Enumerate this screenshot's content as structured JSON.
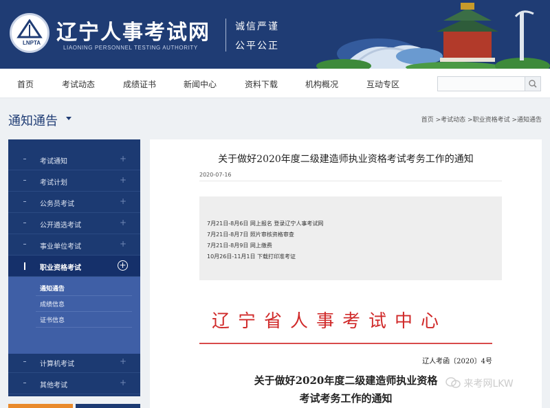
{
  "header": {
    "logo_abbr": "LNPTA",
    "site_title": "辽宁人事考试网",
    "site_subtitle": "LIAONING PERSONNEL TESTING AUTHORITY",
    "motto_line1": "诚信严谨",
    "motto_line2": "公平公正",
    "colors": {
      "brand": "#1f3c74"
    }
  },
  "nav": {
    "items": [
      "首页",
      "考试动态",
      "成绩证书",
      "新闻中心",
      "资料下载",
      "机构概况",
      "互动专区"
    ],
    "search_value": ""
  },
  "section": {
    "title": "通知通告",
    "breadcrumb": "首页 >考试动态 >职业资格考试 >通知通告"
  },
  "sidebar": {
    "items": [
      "考试通知",
      "考试计划",
      "公务员考试",
      "公开遴选考试",
      "事业单位考试",
      "职业资格考试",
      "计算机考试",
      "其他考试"
    ],
    "active_item": "职业资格考试",
    "sub_items": [
      "通知通告",
      "成绩信息",
      "证书信息"
    ],
    "active_sub_item": "通知通告"
  },
  "article": {
    "title": "关于做好2020年度二级建造师执业资格考试考务工作的通知",
    "date": "2020-07-16",
    "schedule": [
      "7月21日-8月6日  网上报名  登录辽宁人事考试网",
      "7月21日-8月7日  照片审核资格审查",
      "7月21日-8月9日  网上缴费",
      "10月26日-11月1日  下载打印准考证"
    ],
    "issuer": "辽宁省人事考试中心",
    "doc_number": "辽人考函〔2020〕4号",
    "doc_title_line1": "关于做好2020年度二级建造师执业资格",
    "doc_title_line2": "考试考务工作的通知",
    "colors": {
      "issuer_red": "#d02a2a"
    }
  },
  "watermark": {
    "text": "来考网LKW"
  }
}
